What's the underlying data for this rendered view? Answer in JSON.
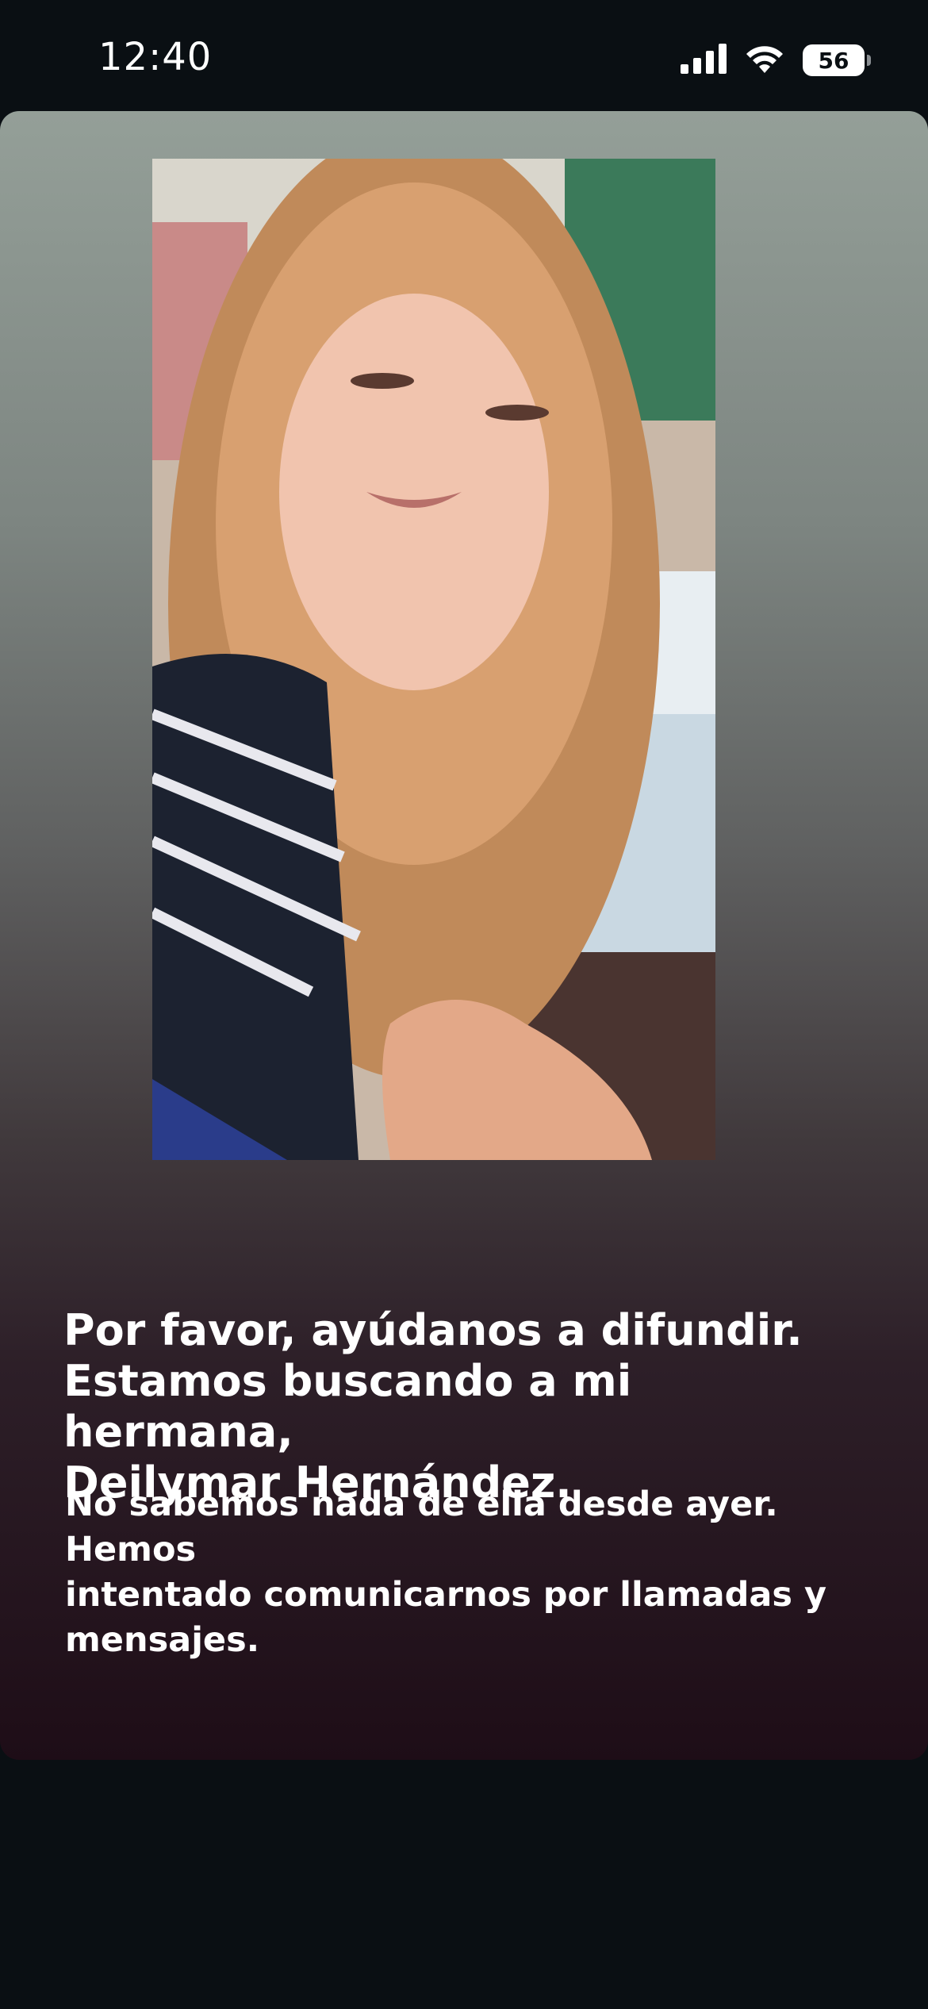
{
  "status_bar": {
    "time": "12:40",
    "battery_level": "56",
    "icons": [
      "cellular-signal-icon",
      "wifi-icon",
      "battery-icon"
    ]
  },
  "story": {
    "photo_icon": "person-selfie-photo",
    "headline_lines": [
      "Por favor, ayúdanos a difundir.",
      "Estamos buscando a mi hermana,",
      "Deilymar Hernández."
    ],
    "body_lines": [
      "No sabemos nada de ella desde ayer. Hemos",
      "intentado comunicarnos por llamadas y",
      "mensajes."
    ]
  },
  "colors": {
    "page_background": "#0a0f13",
    "gradient_top": "#949f98",
    "gradient_bottom": "#1e0d17",
    "text": "#ffffff"
  }
}
